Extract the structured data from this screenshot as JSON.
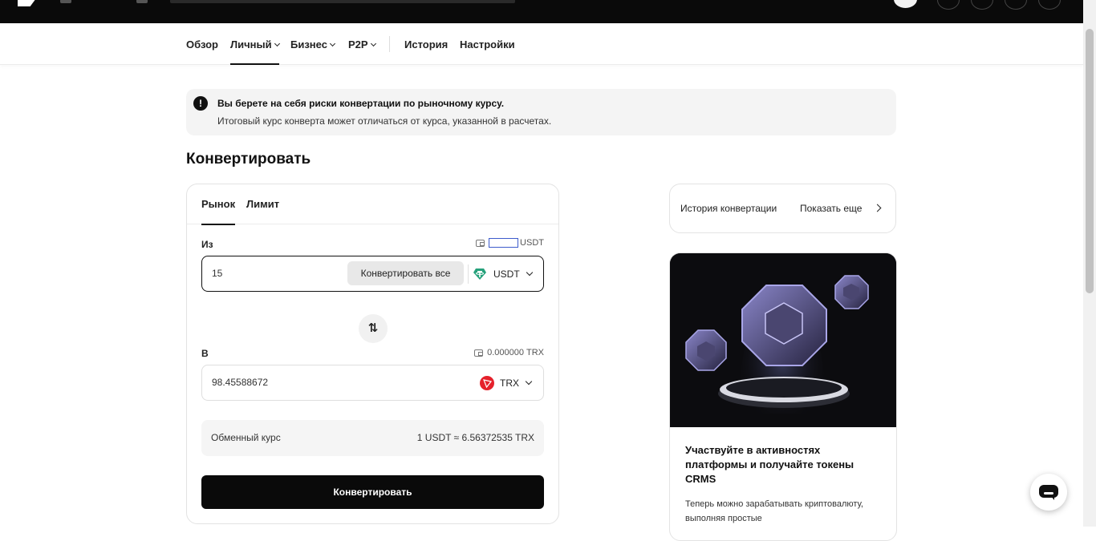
{
  "subnav": {
    "items": [
      {
        "label": "Обзор"
      },
      {
        "label": "Личный"
      },
      {
        "label": "Бизнес"
      },
      {
        "label": "P2P"
      },
      {
        "label": "История"
      },
      {
        "label": "Настройки"
      }
    ],
    "active_index": 1
  },
  "alert": {
    "icon": "exclamation-icon",
    "title": "Вы берете на себя риски конвертации по рыночному курсу.",
    "text": "Итоговый курс конверта может отличаться от курса, указанной в расчетах."
  },
  "page_title": "Конвертировать",
  "convert": {
    "tabs": [
      {
        "label": "Рынок"
      },
      {
        "label": "Лимит"
      }
    ],
    "active_tab": 0,
    "from": {
      "label": "Из",
      "balance_value": "",
      "balance_unit": "USDT",
      "amount": "15",
      "convert_all_label": "Конвертировать все",
      "coin": "USDT",
      "coin_icon": "tether-icon",
      "coin_color": "#26a17b"
    },
    "swap_icon": "swap-arrows-icon",
    "to": {
      "label": "В",
      "balance_value": "0.000000",
      "balance_unit": "TRX",
      "amount": "98.45588672",
      "coin": "TRX",
      "coin_icon": "tron-icon",
      "coin_color": "#e5212b"
    },
    "rate": {
      "label": "Обменный курс",
      "value": "1 USDT ≈ 6.56372535 TRX"
    },
    "submit_label": "Конвертировать"
  },
  "history": {
    "label": "История конвертации",
    "more_label": "Показать еще"
  },
  "promo": {
    "title": "Участвуйте в активностях платформы и получайте токены CRMS",
    "description": "Теперь можно зарабатывать криптовалюту, выполняя простые"
  },
  "colors": {
    "accent": "#0a0a0a",
    "alert_bg": "#f4f4f4"
  }
}
